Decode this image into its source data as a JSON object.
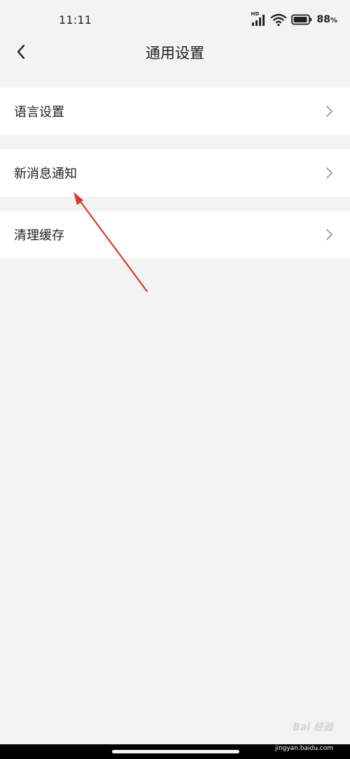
{
  "status_bar": {
    "time": "11:11",
    "network_badge": "HD",
    "battery_percent": "88",
    "battery_suffix": "%",
    "icons": [
      "signal-icon",
      "wifi-icon",
      "battery-icon"
    ]
  },
  "header": {
    "title": "通用设置",
    "back_icon": "chevron-left-icon"
  },
  "settings": {
    "items": [
      {
        "label": "语言设置",
        "icon": "chevron-right-icon"
      },
      {
        "label": "新消息通知",
        "icon": "chevron-right-icon"
      },
      {
        "label": "清理缓存",
        "icon": "chevron-right-icon"
      }
    ]
  },
  "annotation": {
    "arrow_color": "#d93a2b",
    "target": "新消息通知"
  },
  "watermark": {
    "brand": "Bai 经验",
    "url": "jingyan.baidu.com"
  },
  "colors": {
    "background": "#f3f3f3",
    "card": "#ffffff",
    "chevron": "#9a9a9a"
  }
}
